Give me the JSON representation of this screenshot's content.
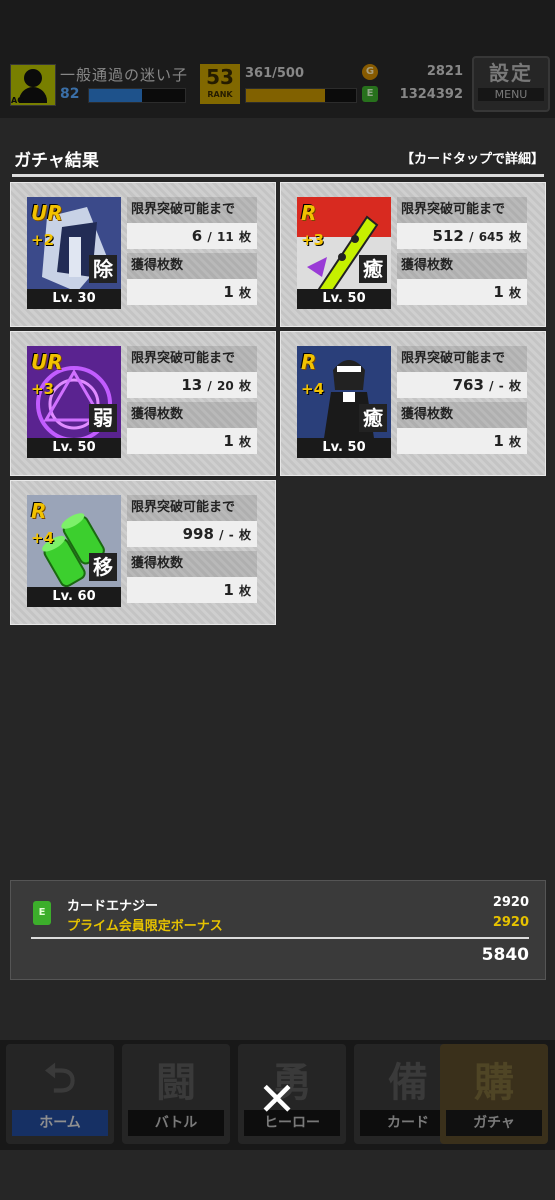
{
  "header": {
    "player_name": "一般通過の迷い子",
    "player_level": "82",
    "xp_fraction": 0.55,
    "rank_value": "53",
    "rank_label": "RANK",
    "rank_progress": "361/500",
    "rank_fraction": 0.72,
    "coins": "2821",
    "energy": "1324392",
    "menu_jp": "設定",
    "menu_en": "MENU",
    "avatar_tag": "AO"
  },
  "section": {
    "title": "ガチャ結果",
    "hint": "【カードタップで詳細】"
  },
  "cards": [
    {
      "rarity": "UR",
      "plus": "+2",
      "role": "除",
      "level": "Lv. 30",
      "limit_label": "限界突破可能まで",
      "limit_current": "6",
      "limit_total": "11",
      "limit_unit": "枚",
      "acquired_label": "獲得枚数",
      "acquired_value": "1",
      "acquired_unit": "枚"
    },
    {
      "rarity": "R",
      "plus": "+3",
      "role": "癒",
      "level": "Lv. 50",
      "limit_label": "限界突破可能まで",
      "limit_current": "512",
      "limit_total": "645",
      "limit_unit": "枚",
      "acquired_label": "獲得枚数",
      "acquired_value": "1",
      "acquired_unit": "枚"
    },
    {
      "rarity": "UR",
      "plus": "+3",
      "role": "弱",
      "level": "Lv. 50",
      "limit_label": "限界突破可能まで",
      "limit_current": "13",
      "limit_total": "20",
      "limit_unit": "枚",
      "acquired_label": "獲得枚数",
      "acquired_value": "1",
      "acquired_unit": "枚"
    },
    {
      "rarity": "R",
      "plus": "+4",
      "role": "癒",
      "level": "Lv. 50",
      "limit_label": "限界突破可能まで",
      "limit_current": "763",
      "limit_total": "-",
      "limit_unit": "枚",
      "acquired_label": "獲得枚数",
      "acquired_value": "1",
      "acquired_unit": "枚"
    },
    {
      "rarity": "R",
      "plus": "+4",
      "role": "移",
      "level": "Lv. 60",
      "limit_label": "限界突破可能まで",
      "limit_current": "998",
      "limit_total": "-",
      "limit_unit": "枚",
      "acquired_label": "獲得枚数",
      "acquired_value": "1",
      "acquired_unit": "枚"
    }
  ],
  "bonus": {
    "energy_label": "カードエナジー",
    "energy_value": "2920",
    "prime_label": "プライム会員限定ボーナス",
    "prime_value": "2920",
    "total": "5840"
  },
  "nav": {
    "home": "ホーム",
    "home_big": "",
    "battle": "バトル",
    "battle_big": "闘",
    "hero": "ヒーロー",
    "hero_big": "勇",
    "card": "カード",
    "card_big": "備",
    "gacha": "ガチャ",
    "gacha_big": "購"
  },
  "close_glyph": "✕",
  "colors": {
    "accent_gold": "#e6c200",
    "rare_blue": "#1d5fd6",
    "energy_green": "#3cae2b"
  }
}
